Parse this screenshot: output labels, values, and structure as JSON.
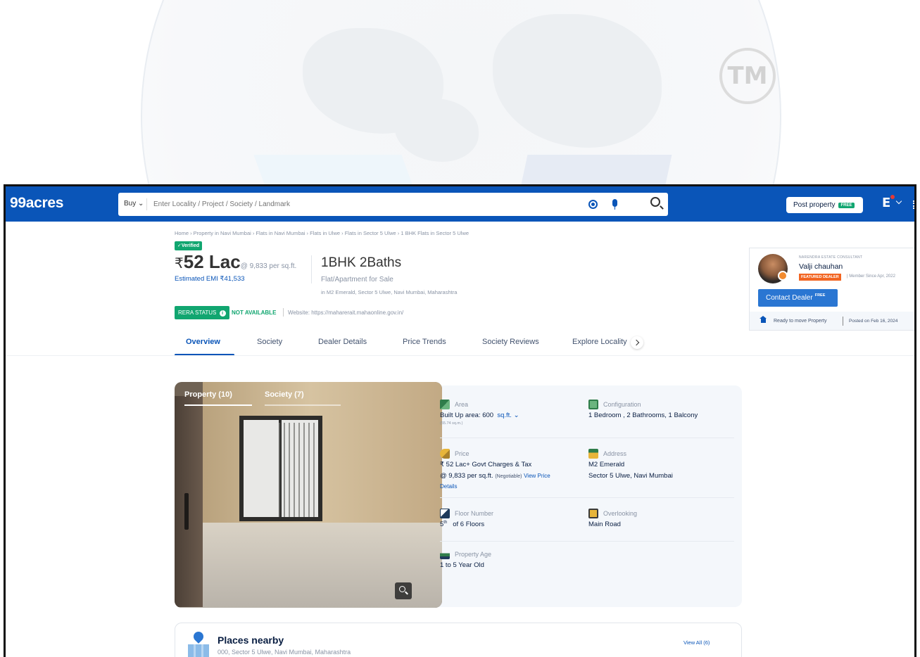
{
  "watermark": {
    "tm_text": "TM"
  },
  "header": {
    "logo": "99acres",
    "search_mode": "Buy",
    "search_placeholder": "Enter Locality / Project / Society / Landmark",
    "post_property_label": "Post property",
    "post_property_badge": "FREE"
  },
  "breadcrumb": "Home › Property in Navi Mumbai › Flats in Navi Mumbai › Flats in Ulwe › Flats in Sector 5 Ulwe › 1 BHK Flats in Sector 5 Ulwe",
  "listing": {
    "verified_label": "✓Verified",
    "price_symbol": "₹",
    "price": "52 Lac",
    "per_sqft": "@ 9,833 per sq.ft.",
    "emi": "Estimated EMI ₹41,533",
    "title": "1BHK 2Baths",
    "subtitle": "Flat/Apartment for Sale",
    "location": "in M2 Emerald, Sector 5 Ulwe, Navi Mumbai, Maharashtra",
    "rera_label": "RERA STATUS",
    "rera_value": "NOT AVAILABLE",
    "website": "Website: https://maharerait.mahaonline.gov.in/"
  },
  "tabs": [
    "Overview",
    "Society",
    "Dealer Details",
    "Price Trends",
    "Society Reviews",
    "Explore Locality"
  ],
  "dealer": {
    "company": "NARENDRA ESTATE CONSULTANT",
    "name": "Valji chauhan",
    "badge": "FEATURED DEALER",
    "member_since": "Member Since Apr, 2022",
    "contact_label": "Contact Dealer",
    "contact_badge": "FREE",
    "ready": "Ready to move Property",
    "posted": "Posted on Feb 16, 2024"
  },
  "photo_tabs": [
    "Property (10)",
    "Society (7)"
  ],
  "details": {
    "area": {
      "label": "Area",
      "value": "Built Up area: 600",
      "unit": "sq.ft.",
      "sub": "(55.74 sq.m.)"
    },
    "configuration": {
      "label": "Configuration",
      "value": "1 Bedroom , 2 Bathrooms, 1 Balcony"
    },
    "price": {
      "label": "Price",
      "value": "₹ 52 Lac+ Govt Charges & Tax",
      "sub": "@ 9,833 per sq.ft.",
      "negotiable": "(Negotiable)",
      "link1": "View Price",
      "link2": "Details"
    },
    "address": {
      "label": "Address",
      "value": "M2 Emerald",
      "sub": "Sector 5 Ulwe, Navi Mumbai"
    },
    "floor": {
      "label": "Floor Number",
      "value": "5",
      "sup": "th",
      "rest": "of 6 Floors"
    },
    "overlooking": {
      "label": "Overlooking",
      "value": "Main Road"
    },
    "age": {
      "label": "Property Age",
      "value": "1 to 5 Year Old"
    }
  },
  "places": {
    "title": "Places nearby",
    "address": "000, Sector 5 Ulwe, Navi Mumbai, Maharashtra",
    "view_all": "View All (6)"
  },
  "colors": {
    "brand_blue": "#0A55B8",
    "green": "#11A670",
    "orange": "#F26522",
    "card_bg": "#F4F7FB"
  }
}
